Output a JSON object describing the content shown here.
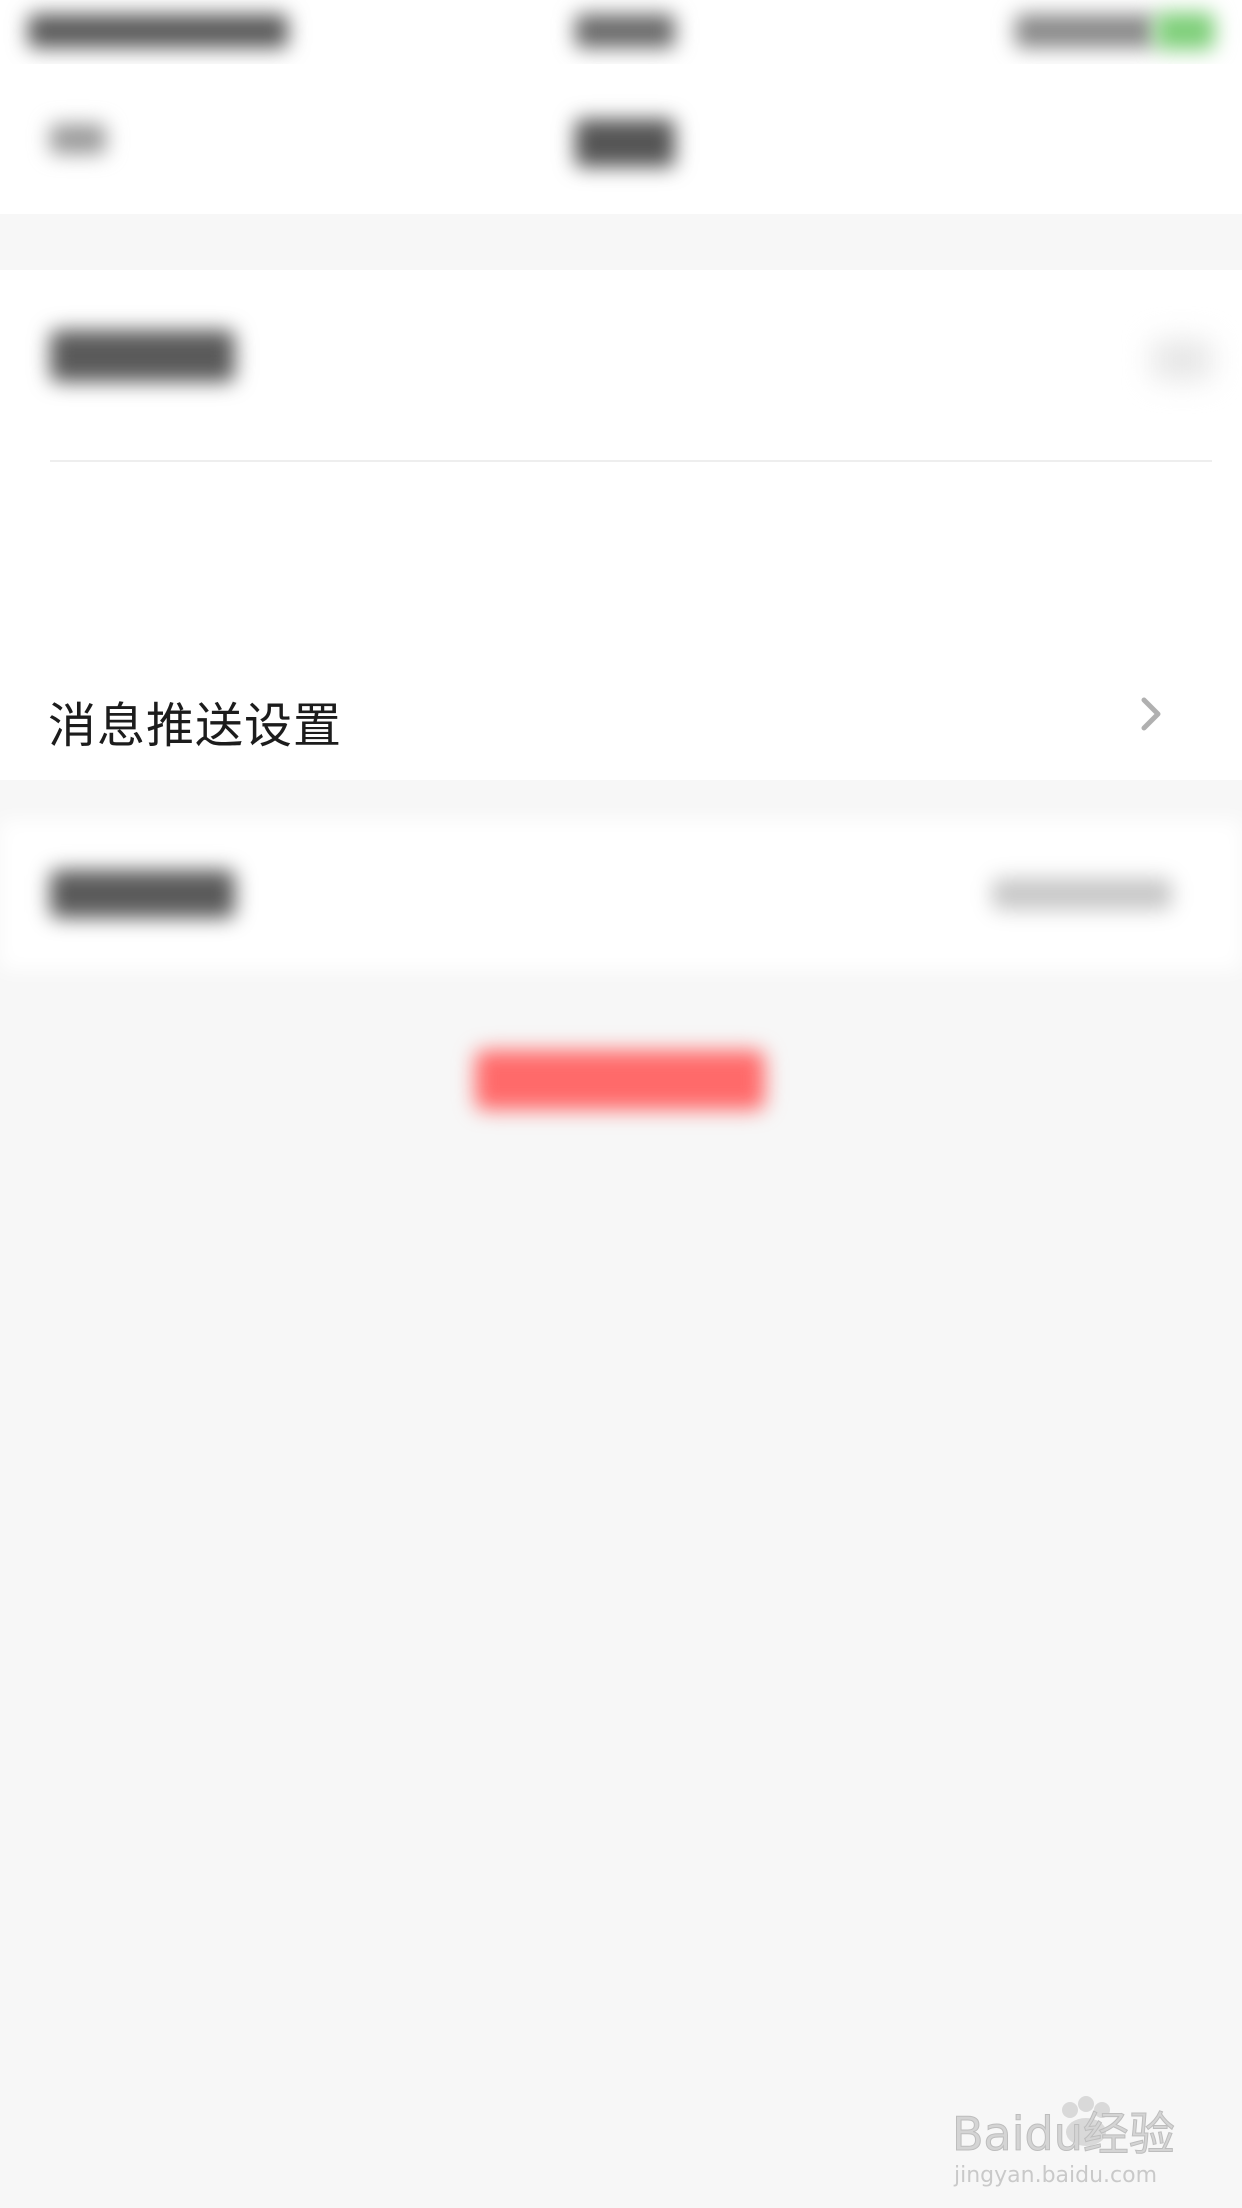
{
  "settings": {
    "push_row": {
      "label": "消息推送设置",
      "icon": "chevron-right-icon"
    }
  },
  "watermark": {
    "brand": "Baidu经验",
    "url": "jingyan.baidu.com"
  },
  "colors": {
    "background": "#f7f7f7",
    "surface": "#ffffff",
    "text": "#1c1c1c",
    "chevron": "#b0b0b0",
    "battery": "#7fcf7a",
    "logout": "#ff6a6a"
  }
}
